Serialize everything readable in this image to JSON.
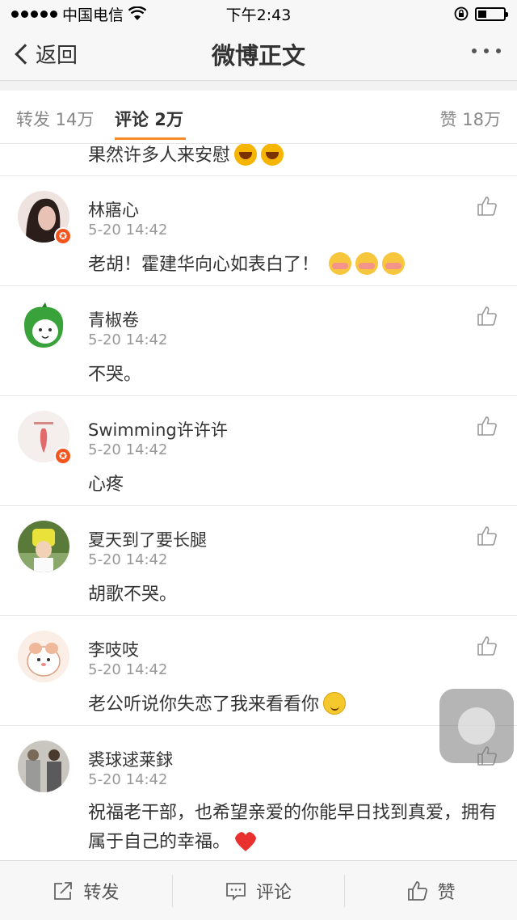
{
  "status_bar": {
    "carrier": "中国电信",
    "time": "下午2:43",
    "icons": [
      "signal-dots-icon",
      "wifi-icon",
      "rotation-lock-icon",
      "battery-icon"
    ]
  },
  "nav": {
    "back_label": "返回",
    "title": "微博正文",
    "more_icon": "more-dots-icon"
  },
  "tabs": {
    "repost": "转发 14万",
    "comment": "评论 2万",
    "like": "赞 18万",
    "accent_color": "#f78b2c"
  },
  "partial_comment": {
    "text": "果然许多人来安慰"
  },
  "comments": [
    {
      "username": "林寤心",
      "time": "5-20 14:42",
      "text": "老胡！霍建华向心如表白了！",
      "vip": true
    },
    {
      "username": "青椒卷",
      "time": "5-20 14:42",
      "text": "不哭。",
      "vip": false
    },
    {
      "username": "Swimming许许许",
      "time": "5-20 14:42",
      "text": "心疼",
      "vip": true
    },
    {
      "username": "夏天到了要长腿",
      "time": "5-20 14:42",
      "text": "胡歌不哭。",
      "vip": false
    },
    {
      "username": "李吱吱",
      "time": "5-20 14:42",
      "text": "老公听说你失恋了我来看看你",
      "vip": false
    },
    {
      "username": "裘球逑莱銶",
      "time": "5-20 14:42",
      "text": "祝福老干部，也希望亲爱的你能早日找到真爱，拥有属于自己的幸福。",
      "vip": false
    }
  ],
  "bottom_bar": {
    "repost": "转发",
    "comment": "评论",
    "like": "赞"
  },
  "colors": {
    "vip_badge": "#f3551e",
    "heart": "#e8312f"
  }
}
